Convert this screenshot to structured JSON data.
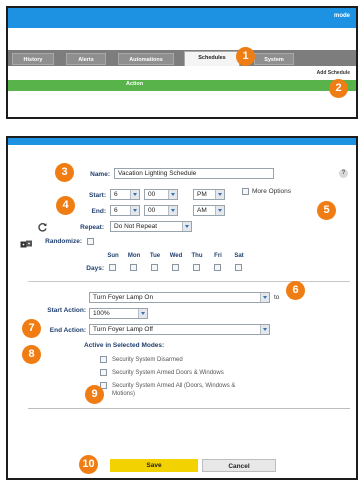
{
  "app": {
    "brand": "mode"
  },
  "tabs": [
    {
      "label": "History"
    },
    {
      "label": "Alerts"
    },
    {
      "label": "Automations"
    },
    {
      "label": "Schedules"
    },
    {
      "label": "System"
    }
  ],
  "add_schedule_label": "Add Schedule",
  "table_header": {
    "action": "Action"
  },
  "badges": [
    "1",
    "2",
    "3",
    "4",
    "5",
    "6",
    "7",
    "8",
    "9",
    "10"
  ],
  "form": {
    "name_label": "Name:",
    "name_value": "Vacation Lighting Schedule",
    "help_icon": "?",
    "start_label": "Start:",
    "start": {
      "hour": "6",
      "minute": "00",
      "ampm": "PM"
    },
    "end_label": "End:",
    "end": {
      "hour": "6",
      "minute": "00",
      "ampm": "AM"
    },
    "more_options_label": "More Options",
    "repeat_label": "Repeat:",
    "repeat_value": "Do Not Repeat",
    "randomize_label": "Randomize:",
    "days_label": "Days:",
    "days": [
      "Sun",
      "Mon",
      "Tue",
      "Wed",
      "Thu",
      "Fri",
      "Sat"
    ],
    "start_action_label": "Start Action:",
    "start_action_value": "Turn Foyer Lamp On",
    "start_action_to": "to",
    "start_action_level": "100%",
    "end_action_label": "End Action:",
    "end_action_value": "Turn Foyer Lamp Off",
    "modes_label": "Active in Selected Modes:",
    "modes": [
      "Security System Disarmed",
      "Security System Armed Doors & Windows",
      "Security System Armed All (Doors, Windows & Motions)"
    ],
    "save_label": "Save",
    "cancel_label": "Cancel"
  },
  "colors": {
    "accent_blue": "#1d91e2",
    "green_bar": "#58b44a",
    "badge_orange": "#f07d13",
    "save_yellow": "#f2d200"
  },
  "icons": {
    "repeat": "refresh-icon",
    "randomize": "dice-icon",
    "help": "help-icon"
  }
}
